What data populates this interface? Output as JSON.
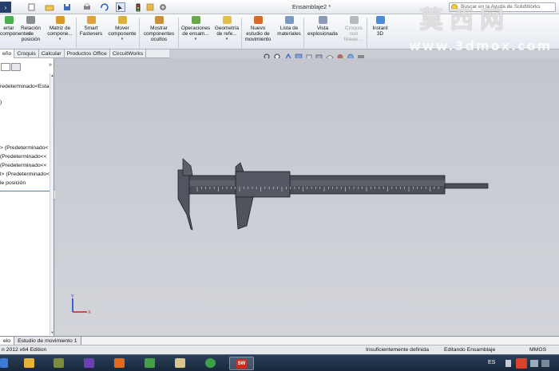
{
  "window": {
    "title": "Ensamblaje2 *"
  },
  "search": {
    "placeholder": "Buscar en la Ayuda de SolidWorks"
  },
  "ribbon": [
    {
      "label": "ertar\ncomponentes",
      "color": "#4caf50"
    },
    {
      "label": "Relación\nde\nposición",
      "color": "#8a8d93"
    },
    {
      "label": "Matriz de\ncompone...",
      "color": "#d89b2a"
    },
    {
      "label": "Smart\nFasteners",
      "color": "#e0a23a"
    },
    {
      "label": "Mover\ncomponente",
      "color": "#d9b240"
    },
    {
      "label": "Mostrar\ncomponentes\nocultos",
      "color": "#c7913b"
    },
    {
      "label": "Operaciones\nde ensam...",
      "color": "#6aa84f"
    },
    {
      "label": "Geometría\nde refe...",
      "color": "#e3c04a"
    },
    {
      "label": "Nuevo\nestudio de\nmovimiento",
      "color": "#d76b2b"
    },
    {
      "label": "Lista de\nmateriales",
      "color": "#7a9ac4"
    },
    {
      "label": "Vista\nexplosionada",
      "color": "#8c9bb5"
    },
    {
      "label": "Croquis\ncon\nlíneas ...",
      "color": "#b5b9c0",
      "disabled": true
    },
    {
      "label": "Instant\n3D",
      "color": "#4a8cd8"
    }
  ],
  "tabs": [
    "eño",
    "Croquis",
    "Calcular",
    "Productos Office",
    "CircuitWorks"
  ],
  "tree": [
    "redeterminado<Esta",
    ")",
    "> (Predeterminado<",
    "(Predeterminado<<",
    "(Predeterminado<<",
    "l> (Predeterminado<",
    "le posición"
  ],
  "tree_arrows": "»",
  "bottom_tabs": [
    "elo",
    "Estudio de movimiento 1"
  ],
  "status": {
    "left": "n 2012 x64 Edition",
    "center": "Insuficientemente definida",
    "right": "Editando Ensamblaje",
    "units": "MMGS"
  },
  "triad": {
    "x_label": "X",
    "y_label": "Y"
  },
  "taskbar": {
    "lang": "ES",
    "active_app": "SW"
  },
  "watermark": {
    "cn": "莫西网",
    "url": "www.3dmox.com"
  },
  "colors": {
    "viewport_top": "#c3c6ce",
    "selected_tree": "#4a7fd0"
  }
}
